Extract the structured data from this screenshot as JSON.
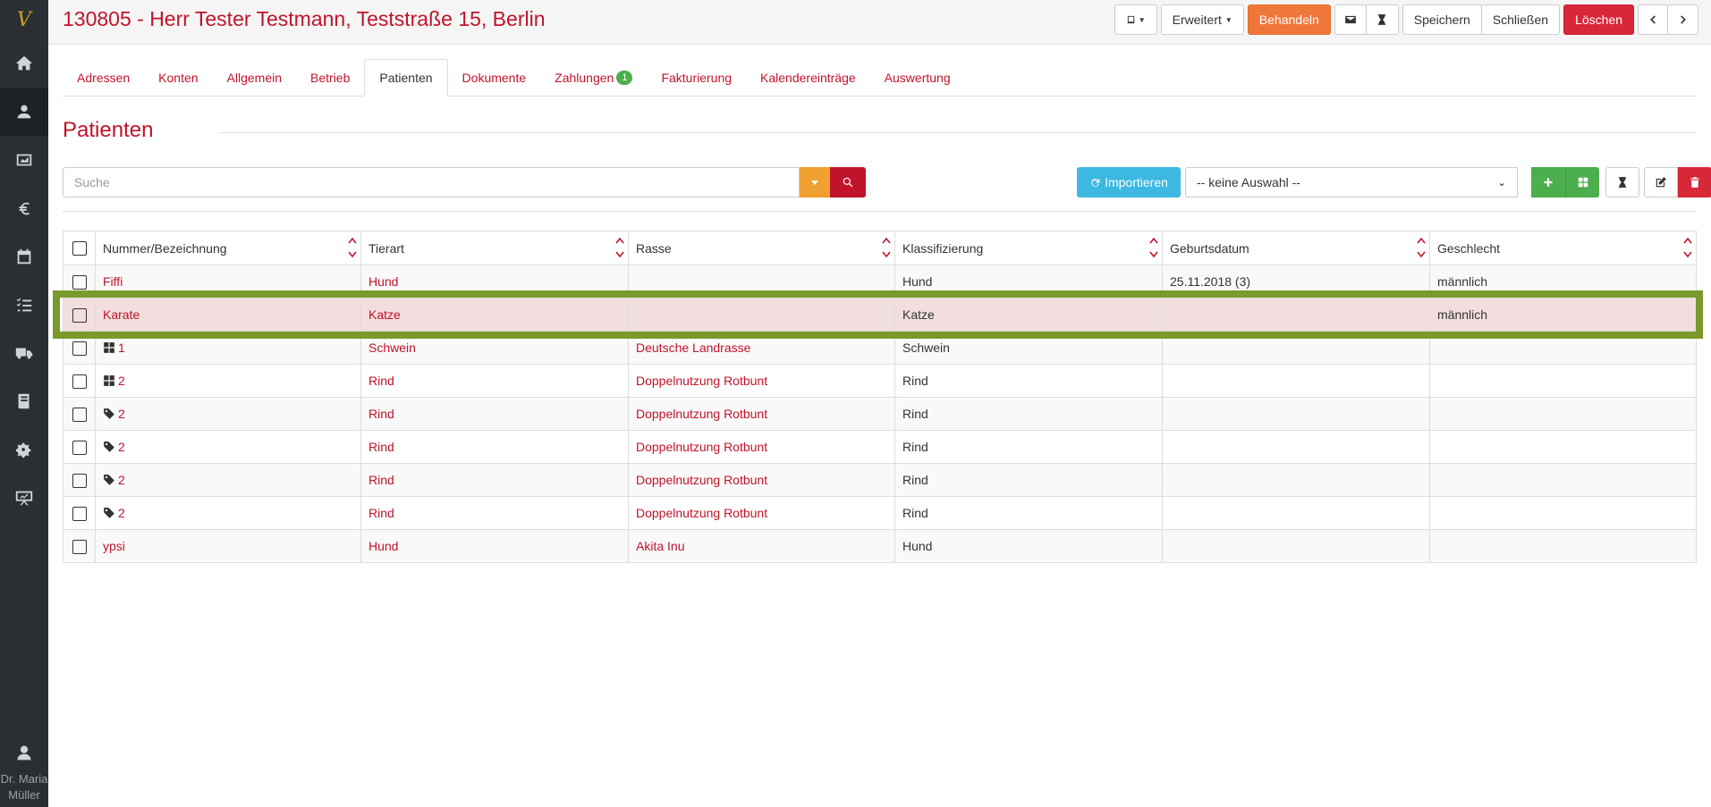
{
  "app": {
    "logo_text": "V",
    "user_name": "Dr. Maria\nMüller"
  },
  "sidebar": {
    "items": [
      {
        "icon": "home-icon"
      },
      {
        "icon": "users-icon"
      },
      {
        "icon": "chart-icon"
      },
      {
        "icon": "euro-icon"
      },
      {
        "icon": "calendar-icon"
      },
      {
        "icon": "tasks-icon"
      },
      {
        "icon": "truck-icon"
      },
      {
        "icon": "book-icon"
      },
      {
        "icon": "gears-icon"
      },
      {
        "icon": "presentation-icon"
      }
    ],
    "active_index": 1
  },
  "header": {
    "title": "130805 - Herr Tester Testmann, Teststraße 15, Berlin",
    "erweitert_label": "Erweitert",
    "behandeln_label": "Behandeln",
    "speichern_label": "Speichern",
    "schliessen_label": "Schließen",
    "loeschen_label": "Löschen"
  },
  "tabs": [
    {
      "label": "Adressen"
    },
    {
      "label": "Konten"
    },
    {
      "label": "Allgemein"
    },
    {
      "label": "Betrieb"
    },
    {
      "label": "Patienten",
      "active": true
    },
    {
      "label": "Dokumente"
    },
    {
      "label": "Zahlungen",
      "badge": "1"
    },
    {
      "label": "Fakturierung"
    },
    {
      "label": "Kalendereinträge"
    },
    {
      "label": "Auswertung"
    }
  ],
  "section": {
    "title": "Patienten",
    "search_placeholder": "Suche",
    "import_label": "Importieren",
    "select_value": "-- keine Auswahl --"
  },
  "table": {
    "columns": [
      "Nummer/Bezeichnung",
      "Tierart",
      "Rasse",
      "Klassifizierung",
      "Geburtsdatum",
      "Geschlecht"
    ],
    "rows": [
      {
        "icon": "",
        "name": "Fiffi",
        "tierart": "Hund",
        "rasse": "",
        "klass": "Hund",
        "geb": "25.11.2018 (3)",
        "geschlecht": "männlich"
      },
      {
        "icon": "",
        "name": "Karate",
        "tierart": "Katze",
        "rasse": "",
        "klass": "Katze",
        "geb": "",
        "geschlecht": "männlich",
        "highlight": true
      },
      {
        "icon": "grid-icon",
        "name": "1",
        "tierart": "Schwein",
        "rasse": "Deutsche Landrasse",
        "klass": "Schwein",
        "geb": "",
        "geschlecht": ""
      },
      {
        "icon": "grid-icon",
        "name": "2",
        "tierart": "Rind",
        "rasse": "Doppelnutzung Rotbunt",
        "klass": "Rind",
        "geb": "",
        "geschlecht": ""
      },
      {
        "icon": "tag-icon",
        "name": "2",
        "tierart": "Rind",
        "rasse": "Doppelnutzung Rotbunt",
        "klass": "Rind",
        "geb": "",
        "geschlecht": ""
      },
      {
        "icon": "tag-icon",
        "name": "2",
        "tierart": "Rind",
        "rasse": "Doppelnutzung Rotbunt",
        "klass": "Rind",
        "geb": "",
        "geschlecht": ""
      },
      {
        "icon": "tag-icon",
        "name": "2",
        "tierart": "Rind",
        "rasse": "Doppelnutzung Rotbunt",
        "klass": "Rind",
        "geb": "",
        "geschlecht": ""
      },
      {
        "icon": "tag-icon",
        "name": "2",
        "tierart": "Rind",
        "rasse": "Doppelnutzung Rotbunt",
        "klass": "Rind",
        "geb": "",
        "geschlecht": ""
      },
      {
        "icon": "",
        "name": "ypsi",
        "tierart": "Hund",
        "rasse": "Akita Inu",
        "klass": "Hund",
        "geb": "",
        "geschlecht": ""
      }
    ]
  },
  "colors": {
    "brand_red": "#c0142a",
    "orange": "#f0773a",
    "green": "#4cae4c",
    "cyan": "#3db8e0",
    "highlight_row": "#f2dede",
    "highlight_frame": "#7a9a2c"
  }
}
